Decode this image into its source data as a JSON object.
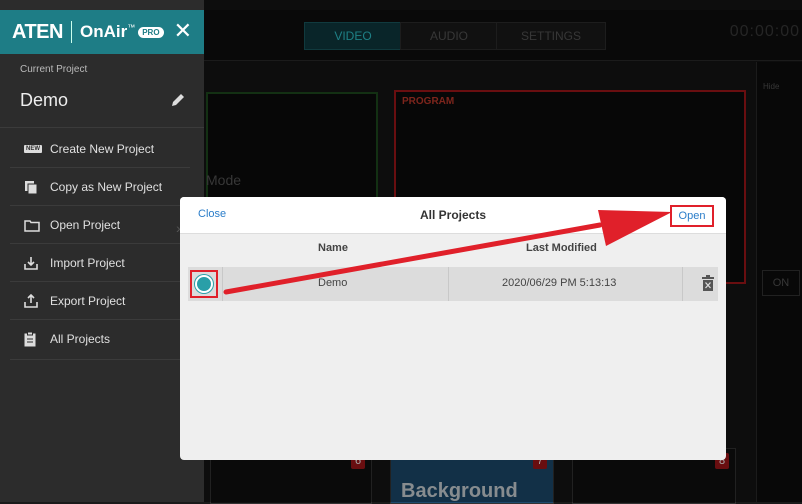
{
  "brand": {
    "logo": "ATEN",
    "app": "OnAir",
    "tm": "™",
    "badge": "PRO"
  },
  "sidebar": {
    "current_label": "Current Project",
    "project_name": "Demo",
    "items": [
      {
        "label": "Create New Project",
        "icon": "new-icon",
        "icon_text": "NEW"
      },
      {
        "label": "Copy as New Project",
        "icon": "copy-icon"
      },
      {
        "label": "Open Project",
        "icon": "folder-icon"
      },
      {
        "label": "Import Project",
        "icon": "import-icon"
      },
      {
        "label": "Export Project",
        "icon": "export-icon"
      },
      {
        "label": "All Projects",
        "icon": "clipboard-icon"
      }
    ]
  },
  "topbar": {
    "tabs": [
      "VIDEO",
      "AUDIO",
      "SETTINGS"
    ],
    "timer": "00:00:00"
  },
  "background": {
    "program_label": "PROGRAM",
    "mode_text": "Mode",
    "on_label": "ON",
    "scene_numbers": [
      "6",
      "7",
      "8"
    ],
    "scene_bg_text": "Background",
    "right_top_text": "Hide"
  },
  "modal": {
    "close_label": "Close",
    "title": "All Projects",
    "open_label": "Open",
    "columns": [
      "Name",
      "Last Modified"
    ],
    "rows": [
      {
        "name": "Demo",
        "modified": "2020/06/29 PM 5:13:13",
        "selected": true
      }
    ]
  },
  "colors": {
    "accent": "#1e7d86",
    "highlight": "#e0202a",
    "link": "#2a7dc9"
  }
}
